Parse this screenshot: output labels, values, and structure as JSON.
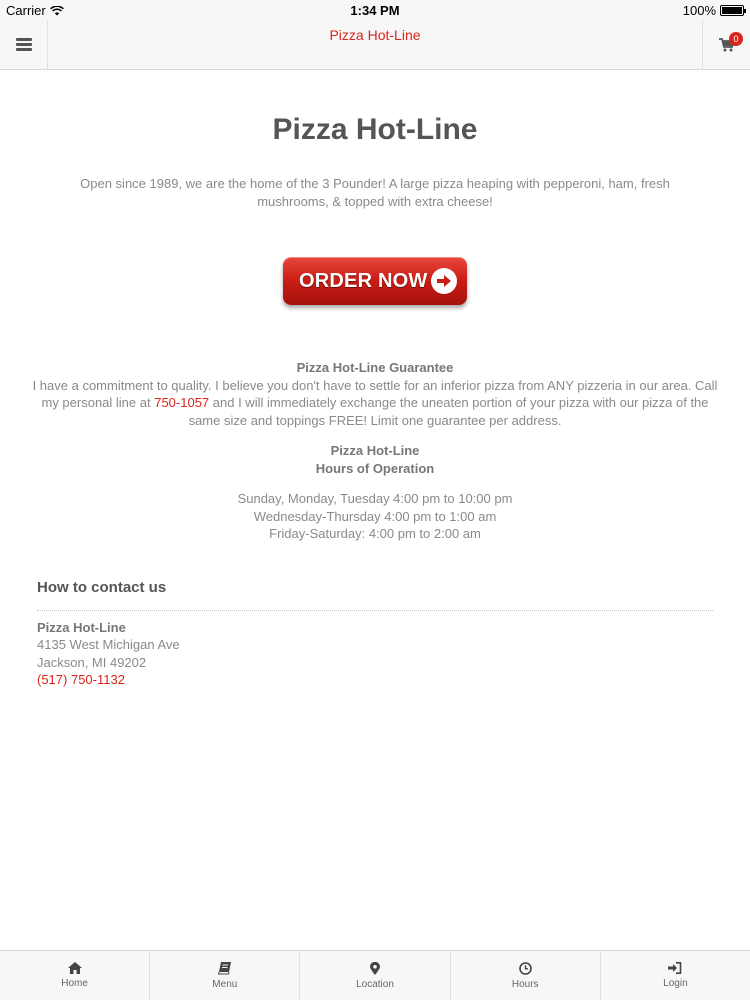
{
  "status_bar": {
    "carrier": "Carrier",
    "time": "1:34 PM",
    "battery": "100%"
  },
  "nav": {
    "title": "Pizza Hot-Line",
    "cart_count": "0"
  },
  "main": {
    "title": "Pizza Hot-Line",
    "intro": "Open since 1989, we are the home of the 3 Pounder! A large pizza heaping with pepperoni, ham, fresh mushrooms, & topped with extra cheese!",
    "order_button": "ORDER NOW",
    "guarantee": {
      "title": "Pizza Hot-Line Guarantee",
      "text_before": "I have a commitment to quality. I believe you don't have to settle for an inferior pizza from ANY pizzeria in our area. Call my personal line at ",
      "phone": "750-1057",
      "text_after": " and I will immediately exchange the uneaten portion of your pizza with our pizza of the same size and toppings FREE! Limit one guarantee per address."
    },
    "hours": {
      "title_line1": "Pizza Hot-Line",
      "title_line2": "Hours of Operation",
      "lines": [
        "Sunday, Monday, Tuesday 4:00 pm to 10:00 pm",
        "Wednesday-Thursday 4:00 pm to 1:00 am",
        "Friday-Saturday: 4:00 pm to 2:00 am"
      ]
    }
  },
  "contact": {
    "heading": "How to contact us",
    "name": "Pizza Hot-Line",
    "address1": "4135 West Michigan Ave",
    "address2": "Jackson, MI 49202",
    "phone": "(517) 750-1132"
  },
  "tabs": [
    {
      "label": "Home",
      "icon": "home-icon"
    },
    {
      "label": "Menu",
      "icon": "book-icon"
    },
    {
      "label": "Location",
      "icon": "map-marker-icon"
    },
    {
      "label": "Hours",
      "icon": "clock-icon"
    },
    {
      "label": "Login",
      "icon": "sign-in-icon"
    }
  ],
  "colors": {
    "accent": "#d9261c",
    "text": "#8a8a8a",
    "heading": "#555555",
    "bar": "#f7f7f7"
  }
}
